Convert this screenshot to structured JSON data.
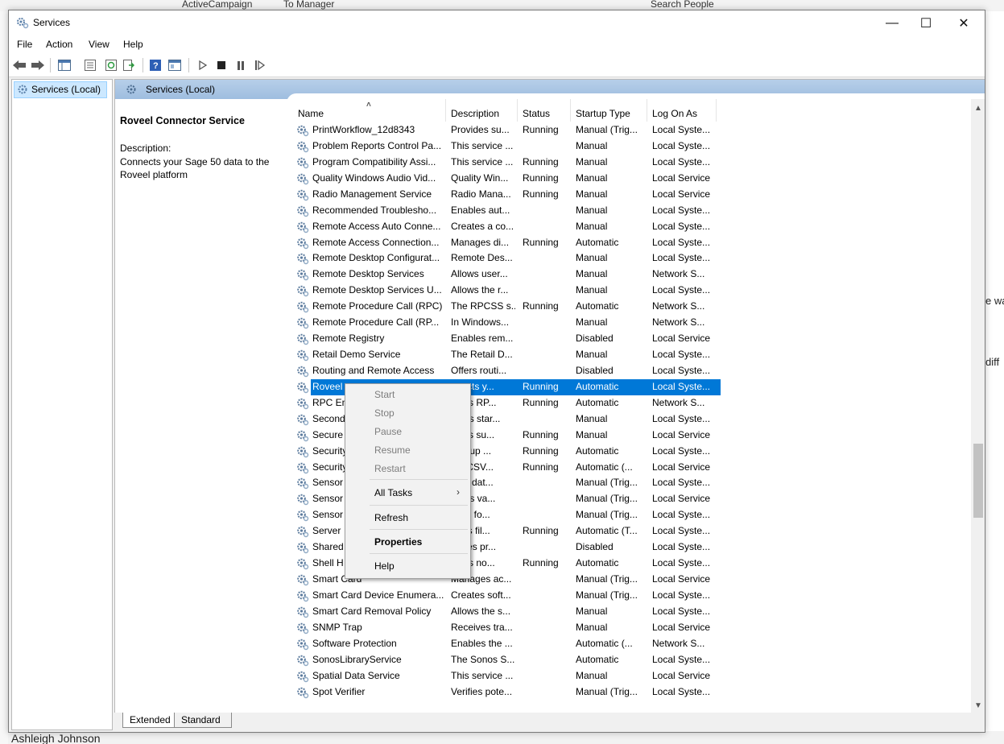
{
  "window": {
    "title": "Services",
    "minimize": "—",
    "maximize": "☐",
    "close": "✕"
  },
  "menu": [
    "File",
    "Action",
    "View",
    "Help"
  ],
  "tree": {
    "root": "Services (Local)"
  },
  "header": {
    "title": "Services (Local)"
  },
  "details": {
    "service_name": "Roveel Connector Service",
    "description_label": "Description:",
    "description": "Connects your Sage 50 data to the Roveel platform"
  },
  "columns": [
    "Name",
    "Description",
    "Status",
    "Startup Type",
    "Log On As"
  ],
  "sort_indicator": "˄",
  "rows": [
    {
      "name": "PrintWorkflow_12d8343",
      "description": "Provides su...",
      "status": "Running",
      "startup": "Manual (Trig...",
      "logon": "Local Syste..."
    },
    {
      "name": "Problem Reports Control Pa...",
      "description": "This service ...",
      "status": "",
      "startup": "Manual",
      "logon": "Local Syste..."
    },
    {
      "name": "Program Compatibility Assi...",
      "description": "This service ...",
      "status": "Running",
      "startup": "Manual",
      "logon": "Local Syste..."
    },
    {
      "name": "Quality Windows Audio Vid...",
      "description": "Quality Win...",
      "status": "Running",
      "startup": "Manual",
      "logon": "Local Service"
    },
    {
      "name": "Radio Management Service",
      "description": "Radio Mana...",
      "status": "Running",
      "startup": "Manual",
      "logon": "Local Service"
    },
    {
      "name": "Recommended Troublesho...",
      "description": "Enables aut...",
      "status": "",
      "startup": "Manual",
      "logon": "Local Syste..."
    },
    {
      "name": "Remote Access Auto Conne...",
      "description": "Creates a co...",
      "status": "",
      "startup": "Manual",
      "logon": "Local Syste..."
    },
    {
      "name": "Remote Access Connection...",
      "description": "Manages di...",
      "status": "Running",
      "startup": "Automatic",
      "logon": "Local Syste..."
    },
    {
      "name": "Remote Desktop Configurat...",
      "description": "Remote Des...",
      "status": "",
      "startup": "Manual",
      "logon": "Local Syste..."
    },
    {
      "name": "Remote Desktop Services",
      "description": "Allows user...",
      "status": "",
      "startup": "Manual",
      "logon": "Network S..."
    },
    {
      "name": "Remote Desktop Services U...",
      "description": "Allows the r...",
      "status": "",
      "startup": "Manual",
      "logon": "Local Syste..."
    },
    {
      "name": "Remote Procedure Call (RPC)",
      "description": "The RPCSS s...",
      "status": "Running",
      "startup": "Automatic",
      "logon": "Network S..."
    },
    {
      "name": "Remote Procedure Call (RP...",
      "description": "In Windows...",
      "status": "",
      "startup": "Manual",
      "logon": "Network S..."
    },
    {
      "name": "Remote Registry",
      "description": "Enables rem...",
      "status": "",
      "startup": "Disabled",
      "logon": "Local Service"
    },
    {
      "name": "Retail Demo Service",
      "description": "The Retail D...",
      "status": "",
      "startup": "Manual",
      "logon": "Local Syste..."
    },
    {
      "name": "Routing and Remote Access",
      "description": "Offers routi...",
      "status": "",
      "startup": "Disabled",
      "logon": "Local Syste..."
    },
    {
      "name": "Roveel",
      "description": "nnects y...",
      "status": "Running",
      "startup": "Automatic",
      "logon": "Local Syste...",
      "selected": true
    },
    {
      "name": "RPC En",
      "description": "olves RP...",
      "status": "Running",
      "startup": "Automatic",
      "logon": "Network S..."
    },
    {
      "name": "Second",
      "description": "ables star...",
      "status": "",
      "startup": "Manual",
      "logon": "Local Syste..."
    },
    {
      "name": "Secure",
      "description": "vides su...",
      "status": "Running",
      "startup": "Manual",
      "logon": "Local Service"
    },
    {
      "name": "Security",
      "description": "startup ...",
      "status": "Running",
      "startup": "Automatic",
      "logon": "Local Syste..."
    },
    {
      "name": "Security",
      "description": "WSCSV...",
      "status": "Running",
      "startup": "Automatic (...",
      "logon": "Local Service"
    },
    {
      "name": "Sensor",
      "description": "vers dat...",
      "status": "",
      "startup": "Manual (Trig...",
      "logon": "Local Syste..."
    },
    {
      "name": "Sensor",
      "description": "nitors va...",
      "status": "",
      "startup": "Manual (Trig...",
      "logon": "Local Service"
    },
    {
      "name": "Sensor",
      "description": "rvice fo...",
      "status": "",
      "startup": "Manual (Trig...",
      "logon": "Local Syste..."
    },
    {
      "name": "Server",
      "description": "ports fil...",
      "status": "Running",
      "startup": "Automatic (T...",
      "logon": "Local Syste..."
    },
    {
      "name": "Shared",
      "description": "nages pr...",
      "status": "",
      "startup": "Disabled",
      "logon": "Local Syste..."
    },
    {
      "name": "Shell H",
      "description": "vides no...",
      "status": "Running",
      "startup": "Automatic",
      "logon": "Local Syste..."
    },
    {
      "name": "Smart Card",
      "description": "Manages ac...",
      "status": "",
      "startup": "Manual (Trig...",
      "logon": "Local Service"
    },
    {
      "name": "Smart Card Device Enumera...",
      "description": "Creates soft...",
      "status": "",
      "startup": "Manual (Trig...",
      "logon": "Local Syste..."
    },
    {
      "name": "Smart Card Removal Policy",
      "description": "Allows the s...",
      "status": "",
      "startup": "Manual",
      "logon": "Local Syste..."
    },
    {
      "name": "SNMP Trap",
      "description": "Receives tra...",
      "status": "",
      "startup": "Manual",
      "logon": "Local Service"
    },
    {
      "name": "Software Protection",
      "description": "Enables the ...",
      "status": "",
      "startup": "Automatic (...",
      "logon": "Network S..."
    },
    {
      "name": "SonosLibraryService",
      "description": "The Sonos S...",
      "status": "",
      "startup": "Automatic",
      "logon": "Local Syste..."
    },
    {
      "name": "Spatial Data Service",
      "description": "This service ...",
      "status": "",
      "startup": "Manual",
      "logon": "Local Service"
    },
    {
      "name": "Spot Verifier",
      "description": "Verifies pote...",
      "status": "",
      "startup": "Manual (Trig...",
      "logon": "Local Syste..."
    }
  ],
  "context_menu": {
    "items": [
      {
        "label": "Start",
        "disabled": true
      },
      {
        "label": "Stop",
        "disabled": true
      },
      {
        "label": "Pause",
        "disabled": true
      },
      {
        "label": "Resume",
        "disabled": true
      },
      {
        "label": "Restart",
        "disabled": true
      },
      {
        "label": "All Tasks",
        "submenu": true
      },
      {
        "label": "Refresh"
      },
      {
        "label": "Properties",
        "bold": true
      },
      {
        "label": "Help"
      }
    ],
    "submenu_arrow": "›"
  },
  "tabs": [
    "Extended",
    "Standard"
  ],
  "background": {
    "top_items": [
      "ActiveCampaign",
      "To Manager",
      "Search People"
    ],
    "right_fragments": [
      "e wa",
      "diff"
    ],
    "bottom_name": "Ashleigh Johnson"
  },
  "colors": {
    "selection": "#0078d7",
    "header_gradient": "#b7cfe9"
  }
}
